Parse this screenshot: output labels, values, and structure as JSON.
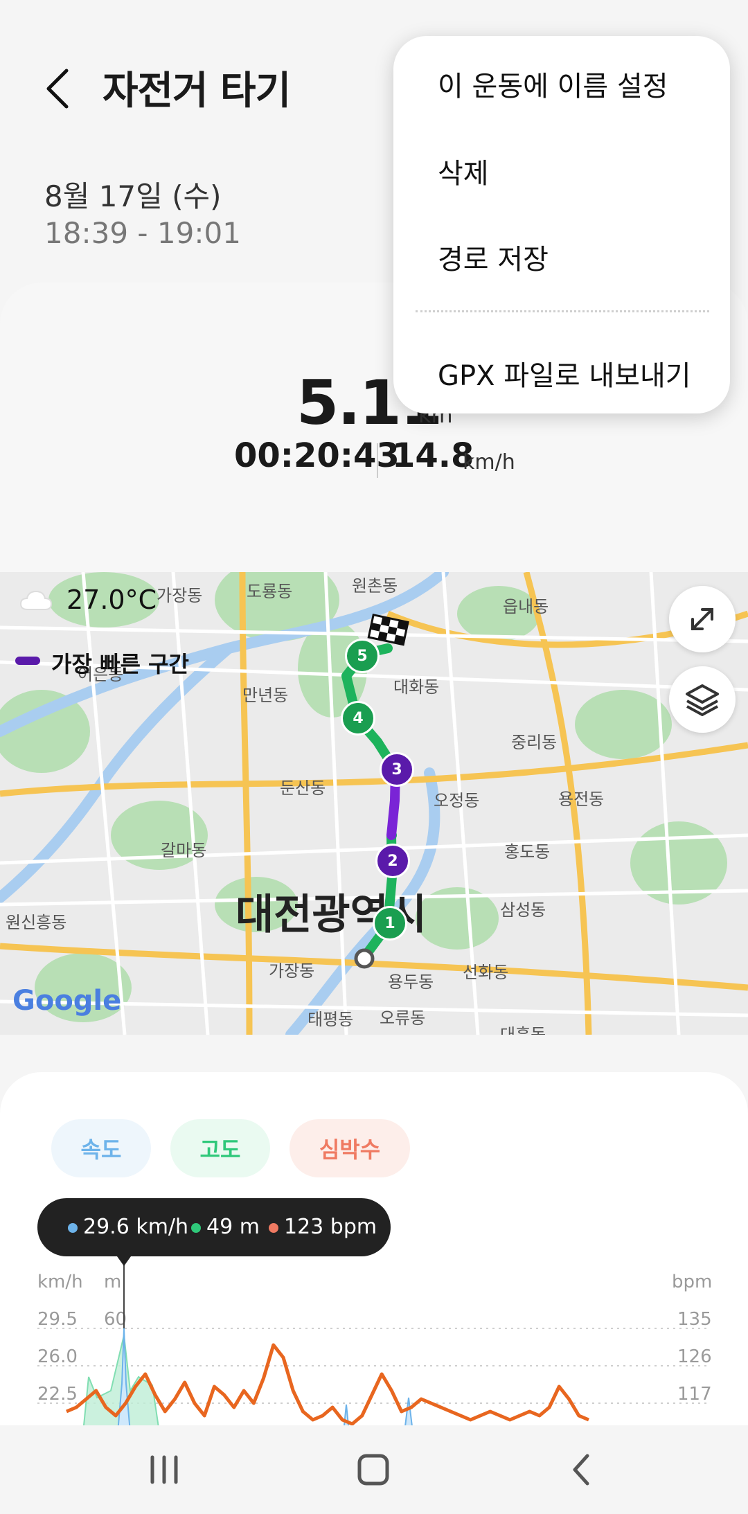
{
  "header": {
    "title": "자전거 타기",
    "date": "8월 17일 (수)",
    "time_range": "18:39 - 19:01"
  },
  "summary": {
    "distance": "5.11",
    "distance_unit": "km",
    "duration": "00:20:43",
    "speed": "14.8",
    "speed_unit": "km/h"
  },
  "menu": {
    "items": [
      {
        "label": "이 운동에 이름 설정"
      },
      {
        "label": "삭제"
      },
      {
        "label": "경로 저장"
      },
      {
        "label": "GPX 파일로 내보내기"
      }
    ]
  },
  "map": {
    "temperature": "27.0°C",
    "fastest_segment_label": "가장 빠른 구간",
    "city_label": "대전광역시",
    "attribution": "Google",
    "route_colors": {
      "normal": "#1db35c",
      "fastest": "#7a24d6"
    },
    "markers": [
      "1",
      "2",
      "3",
      "4",
      "5"
    ],
    "place_labels": [
      {
        "text": "가장동"
      },
      {
        "text": "도룡동"
      },
      {
        "text": "원촌동"
      },
      {
        "text": "읍내동"
      },
      {
        "text": "대화동"
      },
      {
        "text": "만년동"
      },
      {
        "text": "중리동"
      },
      {
        "text": "둔산동"
      },
      {
        "text": "오정동"
      },
      {
        "text": "용전동"
      },
      {
        "text": "갈마동"
      },
      {
        "text": "홍도동"
      },
      {
        "text": "삼성동"
      },
      {
        "text": "원신흥동"
      },
      {
        "text": "가장동"
      },
      {
        "text": "용두동"
      },
      {
        "text": "선화동"
      },
      {
        "text": "태평동"
      },
      {
        "text": "오류동"
      },
      {
        "text": "대흥동"
      },
      {
        "text": "어은동"
      }
    ]
  },
  "chart": {
    "tabs": [
      {
        "label": "속도",
        "color": "#6db3ea",
        "bg": "#eef6fc"
      },
      {
        "label": "고도",
        "color": "#2fc87a",
        "bg": "#eafaf1"
      },
      {
        "label": "심박수",
        "color": "#ef7a62",
        "bg": "#fdeeea"
      }
    ],
    "tooltip": {
      "speed": "29.6 km/h",
      "altitude": "49 m",
      "heart_rate": "123 bpm"
    },
    "axis_units": {
      "speed": "km/h",
      "altitude": "m",
      "heart_rate": "bpm"
    },
    "y_ticks_speed": [
      "29.5",
      "26.0",
      "22.5"
    ],
    "y_ticks_altitude": [
      "60"
    ],
    "y_ticks_heart": [
      "135",
      "126",
      "117"
    ]
  },
  "chart_data": {
    "type": "line",
    "series": [
      {
        "name": "심박수",
        "values": [
          115,
          116,
          118,
          120,
          116,
          114,
          117,
          121,
          124,
          119,
          115,
          118,
          122,
          117,
          114,
          121,
          119,
          116,
          120,
          117,
          123,
          131,
          128,
          120,
          115,
          113,
          114,
          116,
          113,
          112,
          114,
          119,
          124,
          120,
          115,
          116,
          118,
          117,
          116,
          115,
          114,
          113,
          114,
          115,
          114,
          113,
          114,
          115,
          114,
          116,
          121,
          118,
          114,
          113
        ],
        "color": "#e8661f"
      }
    ]
  },
  "navbar": {
    "recent_label": "III"
  },
  "colors": {
    "accent_green": "#1db35c",
    "accent_purple": "#7a24d6",
    "background": "#f5f5f5"
  }
}
